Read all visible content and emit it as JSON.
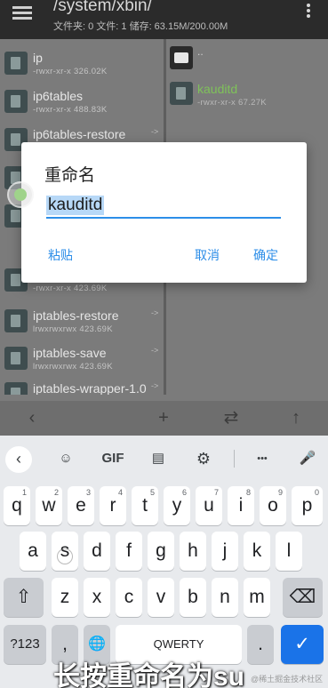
{
  "toolbar": {
    "path": "/system/xbin/",
    "info": "文件夹: 0  文件: 1  储存: 63.15M/200.00M",
    "menu_icon": "menu-icon",
    "overflow_icon": "more-vert-icon"
  },
  "left_pane": {
    "files": [
      {
        "name": "ip",
        "meta": "-rwxr-xr-x 326.02K",
        "link": false
      },
      {
        "name": "ip6tables",
        "meta": "-rwxr-xr-x 488.83K",
        "link": false
      },
      {
        "name": "ip6tables-restore",
        "meta": "",
        "link": true
      },
      {
        "name": "",
        "meta": "",
        "link": false
      },
      {
        "name": "",
        "meta": "",
        "link": false
      },
      {
        "name": "",
        "meta": "-rwxr-xr-x 423.69K",
        "link": false
      },
      {
        "name": "iptables-restore",
        "meta": "lrwxrwxrwx 423.69K",
        "link": true
      },
      {
        "name": "iptables-save",
        "meta": "lrwxrwxrwx 423.69K",
        "link": true
      },
      {
        "name": "iptables-wrapper-1.0",
        "meta": "",
        "link": true
      }
    ],
    "link_arrow": "->"
  },
  "right_pane": {
    "parent_label": "..",
    "file_name": "kauditd",
    "file_meta": "-rwxr-xr-x 67.27K"
  },
  "bottom_bar": {
    "back": "‹",
    "add": "+",
    "swap": "⇄",
    "up": "↑"
  },
  "dialog": {
    "title": "重命名",
    "input_value": "kauditd",
    "paste_label": "粘贴",
    "cancel_label": "取消",
    "ok_label": "确定"
  },
  "keyboard": {
    "toolbar": {
      "back": "‹",
      "sticker": "☺",
      "gif": "GIF",
      "clipboard": "▤",
      "settings": "⚙",
      "more": "•••",
      "mic": "🎤"
    },
    "row1": [
      {
        "key": "q",
        "hint": "1"
      },
      {
        "key": "w",
        "hint": "2"
      },
      {
        "key": "e",
        "hint": "3"
      },
      {
        "key": "r",
        "hint": "4"
      },
      {
        "key": "t",
        "hint": "5"
      },
      {
        "key": "y",
        "hint": "6"
      },
      {
        "key": "u",
        "hint": "7"
      },
      {
        "key": "i",
        "hint": "8"
      },
      {
        "key": "o",
        "hint": "9"
      },
      {
        "key": "p",
        "hint": "0"
      }
    ],
    "row2": [
      "a",
      "s",
      "d",
      "f",
      "g",
      "h",
      "j",
      "k",
      "l"
    ],
    "row3": [
      "z",
      "x",
      "c",
      "v",
      "b",
      "n",
      "m"
    ],
    "shift": "⇧",
    "backspace": "⌫",
    "symbols": "?123",
    "emoji_comma": ",",
    "globe": "🌐",
    "space": "QWERTY",
    "period": ".",
    "enter": "✓"
  },
  "caption": "长按重命名为su",
  "watermark": "@稀土掘金技术社区"
}
